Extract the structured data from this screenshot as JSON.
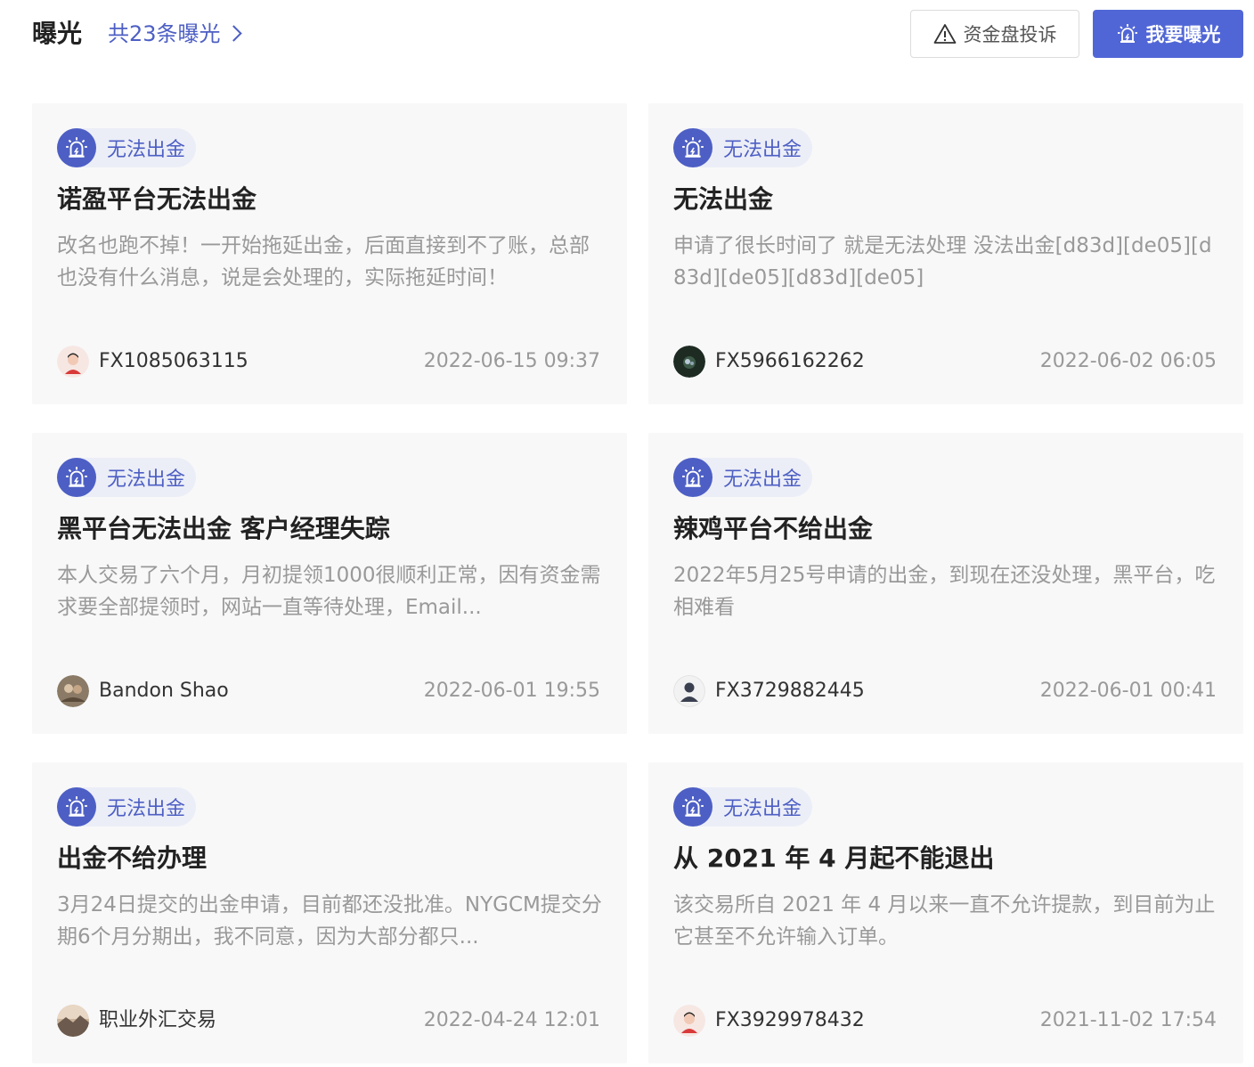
{
  "header": {
    "title": "曝光",
    "count_link": "共23条曝光",
    "complaint_button": "资金盘投诉",
    "expose_button": "我要曝光"
  },
  "colors": {
    "accent": "#4d5fc4",
    "button_primary": "#5166d6",
    "card_bg": "#f8f8f9",
    "tag_bg": "#eceef7"
  },
  "cards": [
    {
      "tag": "无法出金",
      "title": "诺盈平台无法出金",
      "desc": "改名也跑不掉！一开始拖延出金，后面直接到不了账，总部也没有什么消息，说是会处理的，实际拖延时间！",
      "author": "FX1085063115",
      "date": "2022-06-15 09:37",
      "avatar_icon": "cartoon-person-avatar-icon"
    },
    {
      "tag": "无法出金",
      "title": "无法出金",
      "desc": "申请了很长时间了 就是无法处理 没法出金[d83d][de05][d83d][de05][d83d][de05]",
      "author": "FX5966162262",
      "date": "2022-06-02 06:05",
      "avatar_icon": "dark-nature-photo-avatar-icon"
    },
    {
      "tag": "无法出金",
      "title": "黑平台无法出金 客户经理失踪",
      "desc": "本人交易了六个月，月初提领1000很顺利正常，因有资金需求要全部提领时，网站一直等待处理，Email...",
      "author": "Bandon Shao",
      "date": "2022-06-01 19:55",
      "avatar_icon": "photo-avatar-icon"
    },
    {
      "tag": "无法出金",
      "title": "辣鸡平台不给出金",
      "desc": "2022年5月25号申请的出金，到现在还没处理，黑平台，吃相难看",
      "author": "FX3729882445",
      "date": "2022-06-01 00:41",
      "avatar_icon": "default-user-silhouette-avatar-icon"
    },
    {
      "tag": "无法出金",
      "title": "出金不给办理",
      "desc": "3月24日提交的出金申请，目前都还没批准。NYGCM提交分期6个月分期出，我不同意，因为大部分都只...",
      "author": "职业外汇交易",
      "date": "2022-04-24 12:01",
      "avatar_icon": "landscape-photo-avatar-icon"
    },
    {
      "tag": "无法出金",
      "title": "从 2021 年 4 月起不能退出",
      "desc": "该交易所自 2021 年 4 月以来一直不允许提款，到目前为止它甚至不允许输入订单。",
      "author": "FX3929978432",
      "date": "2021-11-02 17:54",
      "avatar_icon": "cartoon-person-avatar-icon"
    }
  ]
}
